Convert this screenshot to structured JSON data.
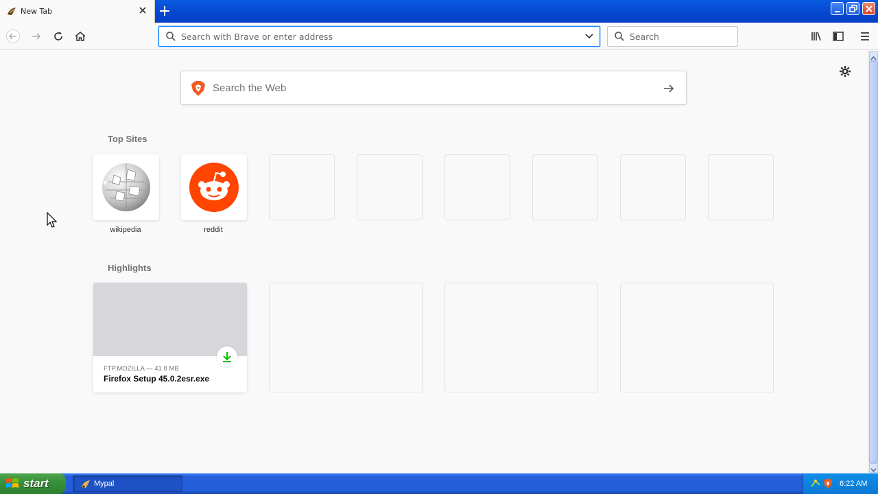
{
  "tab": {
    "title": "New Tab"
  },
  "navbar": {
    "url_placeholder": "Search with Brave or enter address",
    "search_placeholder": "Search"
  },
  "content": {
    "web_search_placeholder": "Search the Web",
    "top_sites_title": "Top Sites",
    "top_sites": [
      {
        "label": "wikipedia",
        "icon": "wikipedia-globe-icon"
      },
      {
        "label": "reddit",
        "icon": "reddit-icon"
      },
      {
        "label": ""
      },
      {
        "label": ""
      },
      {
        "label": ""
      },
      {
        "label": ""
      },
      {
        "label": ""
      },
      {
        "label": ""
      }
    ],
    "highlights_title": "Highlights",
    "highlights": [
      {
        "meta": "FTP.MOZILLA — 41.8 MB",
        "name": "Firefox Setup 45.0.2esr.exe",
        "icon": "download-icon"
      }
    ]
  },
  "taskbar": {
    "start_label": "start",
    "task_label": "Mypal",
    "clock": "6:22 AM"
  },
  "colors": {
    "accent": "#0a84ff",
    "reddit": "#ff4500",
    "download": "#12bc00",
    "xp_blue": "#245edb",
    "xp_green": "#38913a"
  }
}
